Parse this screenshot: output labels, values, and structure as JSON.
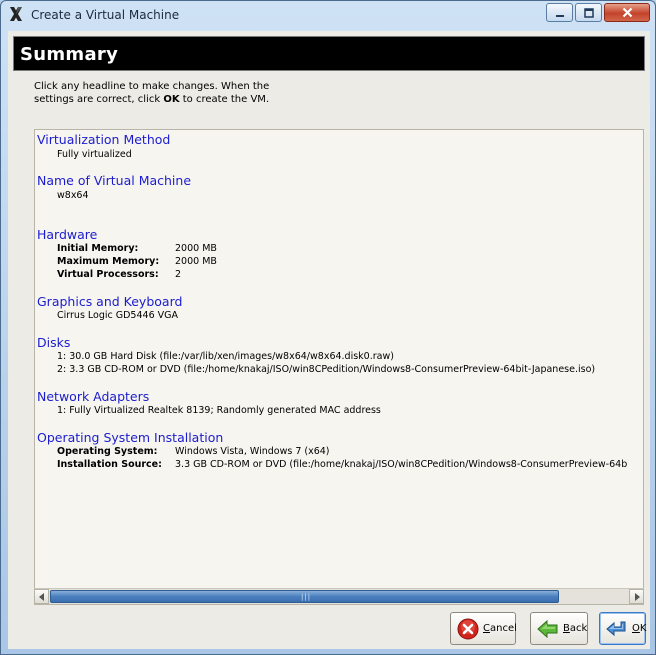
{
  "window": {
    "title": "Create a Virtual Machine"
  },
  "banner": {
    "title": "Summary"
  },
  "instructions": {
    "pre": "Click any headline to make changes.  When the settings are correct, click ",
    "ok": "OK",
    "post": " to create the VM."
  },
  "sections": {
    "virtualization": {
      "head": "Virtualization Method",
      "value": "Fully virtualized"
    },
    "name": {
      "head": "Name of Virtual Machine",
      "value": "w8x64"
    },
    "hardware": {
      "head": "Hardware",
      "initial_memory_label": "Initial Memory:",
      "initial_memory": "2000 MB",
      "max_memory_label": "Maximum Memory:",
      "max_memory": "2000 MB",
      "vcpu_label": "Virtual Processors:",
      "vcpu": "2"
    },
    "graphics": {
      "head": "Graphics and Keyboard",
      "value": "Cirrus Logic GD5446 VGA"
    },
    "disks": {
      "head": "Disks",
      "disk1": "1: 30.0 GB Hard Disk (file:/var/lib/xen/images/w8x64/w8x64.disk0.raw)",
      "disk2": "2: 3.3 GB CD-ROM or DVD (file:/home/knakaj/ISO/win8CPedition/Windows8-ConsumerPreview-64bit-Japanese.iso)"
    },
    "network": {
      "head": "Network Adapters",
      "value": "1: Fully Virtualized Realtek 8139; Randomly generated MAC address"
    },
    "os": {
      "head": "Operating System Installation",
      "os_label": "Operating System:",
      "os_value": "Windows Vista, Windows 7 (x64)",
      "src_label": "Installation Source:",
      "src_value": "3.3 GB CD-ROM or DVD (file:/home/knakaj/ISO/win8CPedition/Windows8-ConsumerPreview-64b"
    }
  },
  "scrollbar": {
    "position_fraction": 0.0,
    "visible_fraction": 0.88
  },
  "buttons": {
    "cancel_mnemonic": "C",
    "cancel_rest": "ancel",
    "back_mnemonic": "B",
    "back_rest": "ack",
    "ok_mnemonic": "O",
    "ok_rest": "K"
  },
  "icons": {
    "app": "x-logo-icon",
    "minimize": "minimize-icon",
    "maximize": "maximize-icon",
    "close": "close-icon",
    "cancel": "cancel-icon",
    "back": "back-arrow-icon",
    "ok": "ok-arrow-icon"
  },
  "colors": {
    "headline": "#1c1ccf",
    "banner_bg": "#000000",
    "close_button": "#c4432b"
  }
}
